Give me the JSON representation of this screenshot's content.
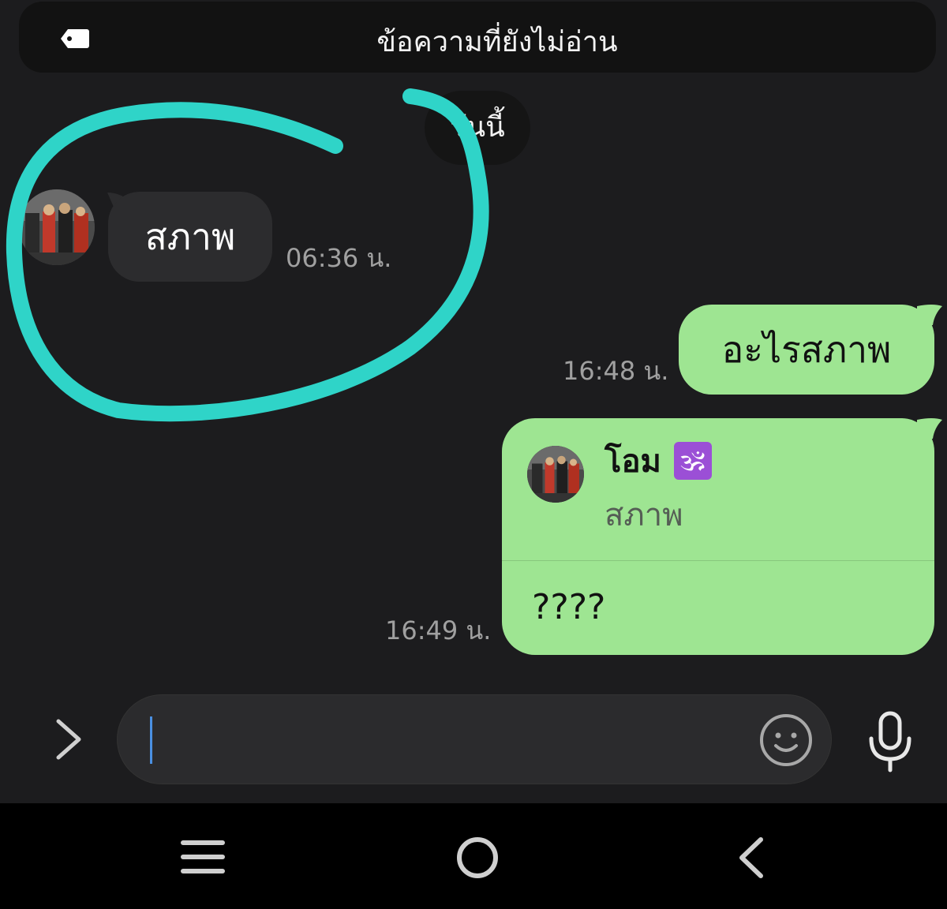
{
  "header": {
    "unread_text": "ข้อความที่ยังไม่อ่าน",
    "icon": "tag-icon"
  },
  "date_chip": "วันนี้",
  "messages": [
    {
      "direction": "incoming",
      "text": "สภาพ",
      "time": "06:36 น."
    },
    {
      "direction": "outgoing",
      "text": "อะไรสภาพ",
      "time": "16:48 น."
    },
    {
      "direction": "outgoing",
      "reply_to": {
        "sender": "โอม",
        "sender_badge": "🕉",
        "quoted_text": "สภาพ"
      },
      "text": "????",
      "time": "16:49 น."
    }
  ],
  "input": {
    "placeholder": "",
    "value": ""
  },
  "icons": {
    "expand": "chevron-right-icon",
    "emoji": "smiley-icon",
    "mic": "microphone-icon",
    "nav_recent": "menu-lines-icon",
    "nav_home": "home-circle-icon",
    "nav_back": "back-chevron-icon"
  },
  "colors": {
    "background": "#1c1c1e",
    "incoming_bubble": "#2c2c2e",
    "outgoing_bubble": "#9ee592",
    "annotation_stroke": "#2fd4c8",
    "cursor": "#4a90e2"
  }
}
